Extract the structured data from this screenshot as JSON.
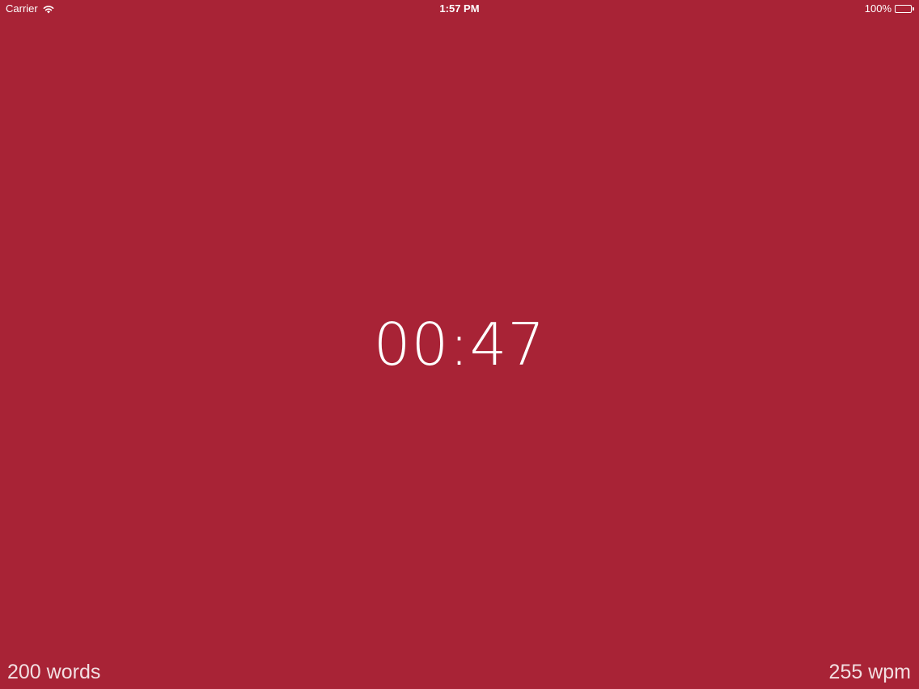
{
  "status_bar": {
    "carrier": "Carrier",
    "time": "1:57 PM",
    "battery": "100%",
    "icons": {
      "wifi": "wifi-icon",
      "battery": "battery-icon"
    }
  },
  "timer": {
    "display": "00:47"
  },
  "footer": {
    "word_count": "200 words",
    "wpm": "255 wpm"
  },
  "colors": {
    "background": "#A82336",
    "text": "#FFFFFF"
  }
}
